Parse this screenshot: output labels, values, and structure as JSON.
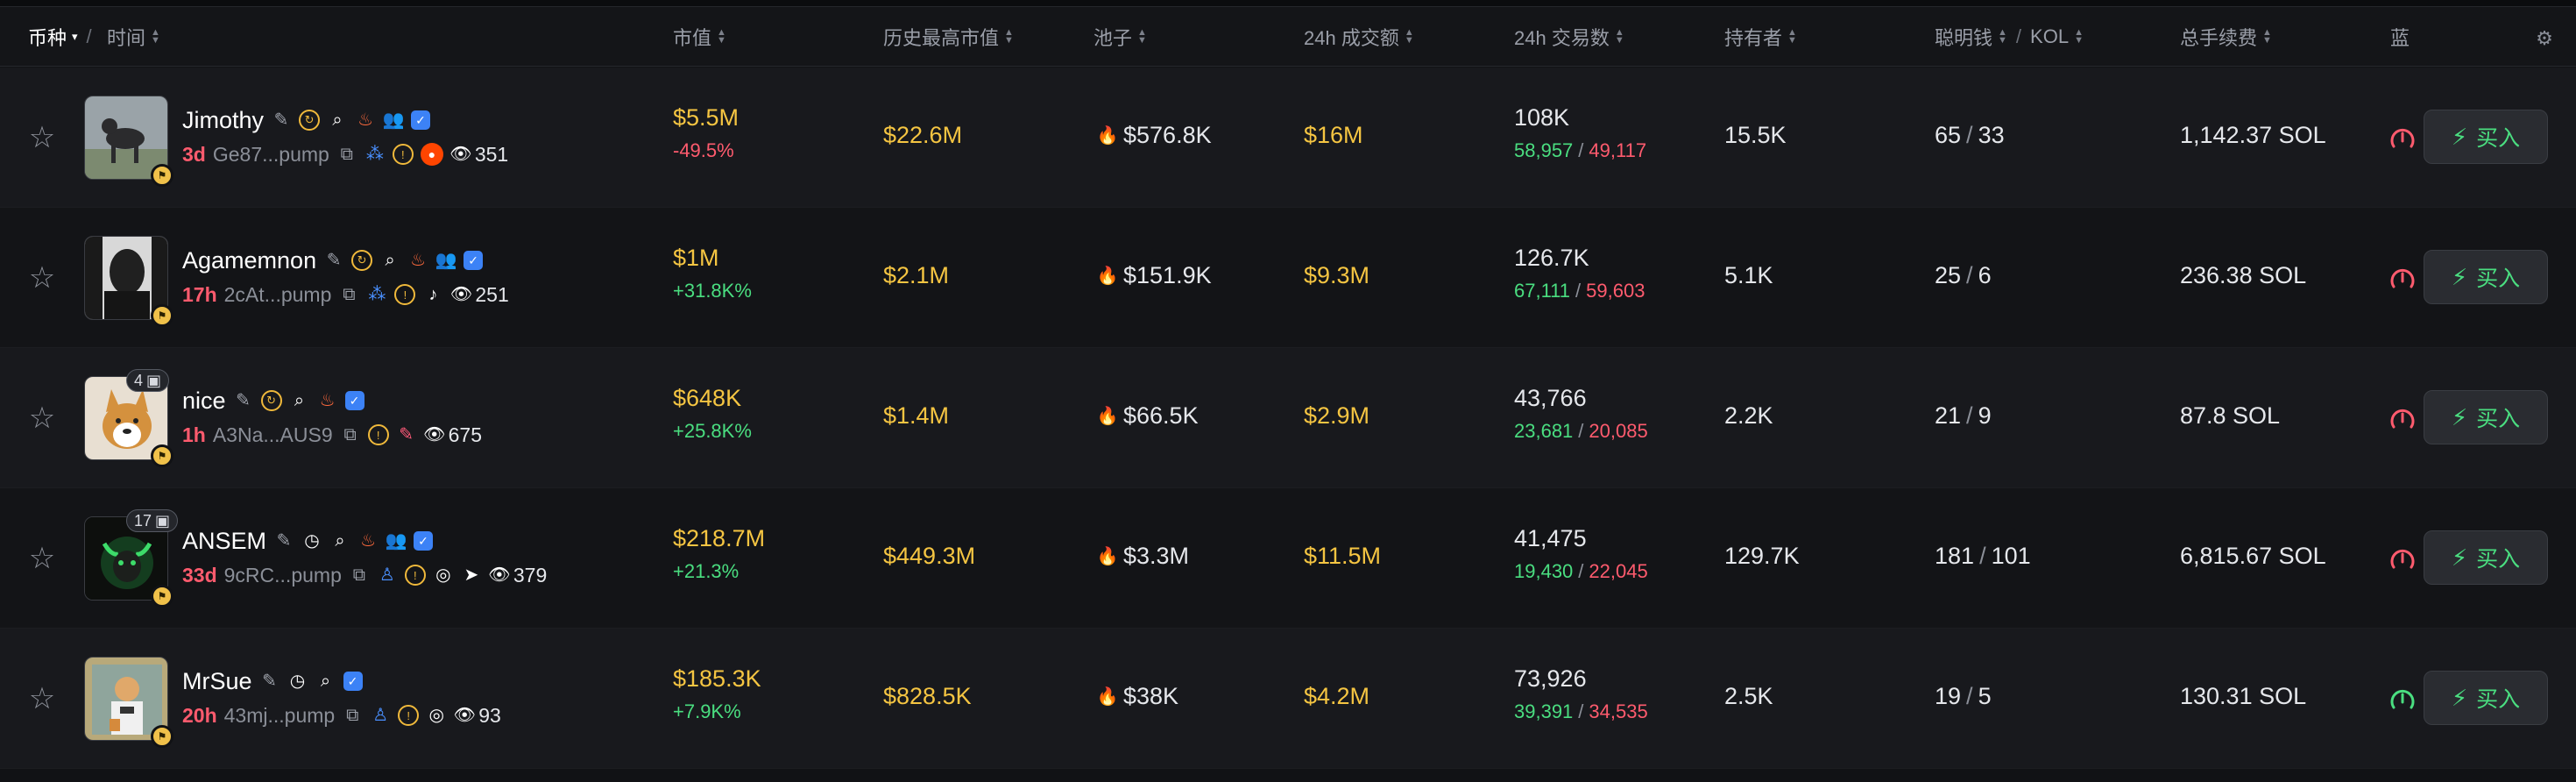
{
  "header": {
    "coin_label": "币种",
    "time_label": "时间",
    "market_cap": "市值",
    "ath_market_cap": "历史最高市值",
    "pool": "池子",
    "volume_24h": "24h 成交额",
    "txns_24h": "24h 交易数",
    "holders": "持有者",
    "smart_money": "聪明钱",
    "kol": "KOL",
    "total_fees": "总手续费",
    "bluechip": "蓝",
    "sep": "/",
    "caret": "▾"
  },
  "actions": {
    "buy_label": "买入"
  },
  "colors": {
    "accent_gold": "#f5c542",
    "positive": "#4ade80",
    "negative": "#ff5b6e",
    "background": "#111215"
  },
  "rows": [
    {
      "name": "Jimothy",
      "age": "3d",
      "address": "Ge87...pump",
      "views": "351",
      "social": [
        "reddit"
      ],
      "count_badge": "",
      "market_cap": "$5.5M",
      "change": "-49.5%",
      "change_dir": "neg",
      "ath": "$22.6M",
      "pool": "$576.8K",
      "volume": "$16M",
      "txns": "108K",
      "buys": "58,957",
      "sells": "49,117",
      "holders": "15.5K",
      "smart": "65",
      "kol": "33",
      "fees": "1,142.37 SOL"
    },
    {
      "name": "Agamemnon",
      "age": "17h",
      "address": "2cAt...pump",
      "views": "251",
      "social": [
        "tiktok"
      ],
      "count_badge": "",
      "market_cap": "$1M",
      "change": "+31.8K%",
      "change_dir": "pos",
      "ath": "$2.1M",
      "pool": "$151.9K",
      "volume": "$9.3M",
      "txns": "126.7K",
      "buys": "67,111",
      "sells": "59,603",
      "holders": "5.1K",
      "smart": "25",
      "kol": "6",
      "fees": "236.38 SOL"
    },
    {
      "name": "nice",
      "age": "1h",
      "address": "A3Na...AUS9",
      "views": "675",
      "social": [
        "feather"
      ],
      "count_badge": "4",
      "market_cap": "$648K",
      "change": "+25.8K%",
      "change_dir": "pos",
      "ath": "$1.4M",
      "pool": "$66.5K",
      "volume": "$2.9M",
      "txns": "43,766",
      "buys": "23,681",
      "sells": "20,085",
      "holders": "2.2K",
      "smart": "21",
      "kol": "9",
      "fees": "87.8 SOL"
    },
    {
      "name": "ANSEM",
      "age": "33d",
      "address": "9cRC...pump",
      "views": "379",
      "social": [
        "globe",
        "telegram"
      ],
      "count_badge": "17",
      "market_cap": "$218.7M",
      "change": "+21.3%",
      "change_dir": "pos",
      "ath": "$449.3M",
      "pool": "$3.3M",
      "volume": "$11.5M",
      "txns": "41,475",
      "buys": "19,430",
      "sells": "22,045",
      "holders": "129.7K",
      "smart": "181",
      "kol": "101",
      "fees": "6,815.67 SOL"
    },
    {
      "name": "MrSue",
      "age": "20h",
      "address": "43mj...pump",
      "views": "93",
      "social": [
        "globe"
      ],
      "count_badge": "",
      "market_cap": "$185.3K",
      "change": "+7.9K%",
      "change_dir": "pos",
      "ath": "$828.5K",
      "pool": "$38K",
      "volume": "$4.2M",
      "txns": "73,926",
      "buys": "39,391",
      "sells": "34,535",
      "holders": "2.5K",
      "smart": "19",
      "kol": "5",
      "fees": "130.31 SOL"
    }
  ]
}
